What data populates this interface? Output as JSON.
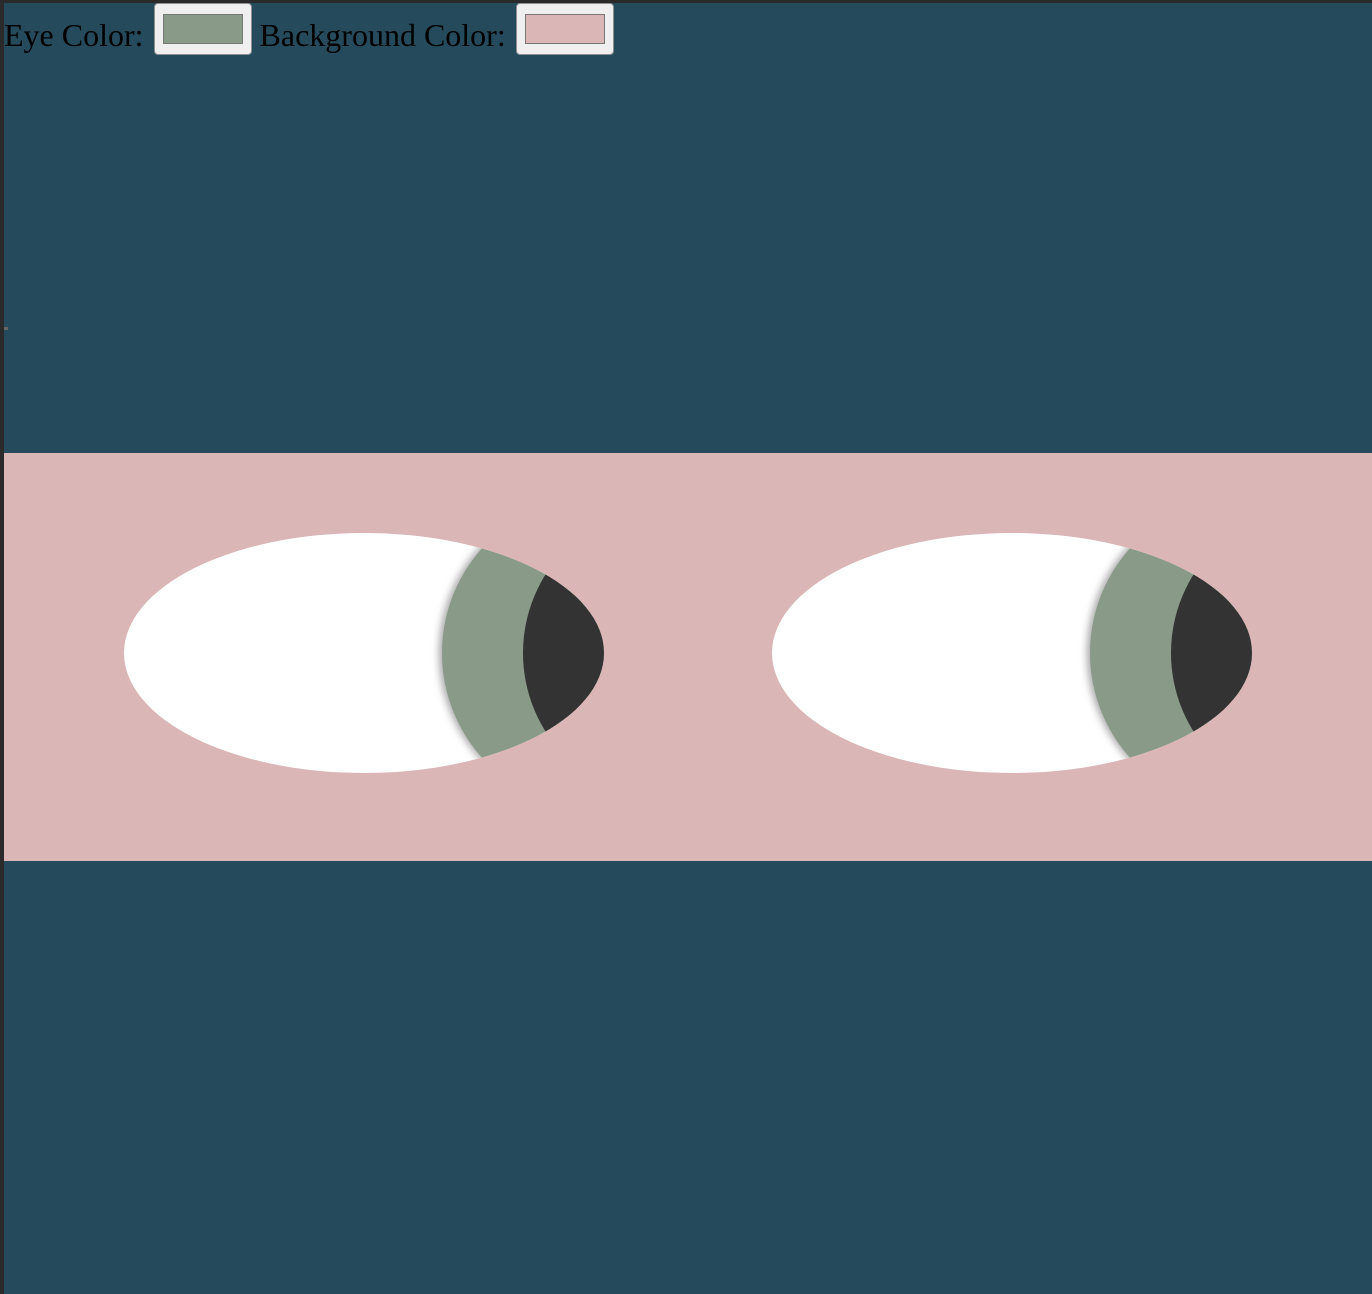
{
  "controls": {
    "eye_color_label": "Eye Color:",
    "background_color_label": "Background Color:",
    "eye_color_value": "#8a9a88",
    "background_color_value": "#dbb6b7"
  },
  "colors": {
    "page_background": "#244a5c",
    "band_background": "#dbb6b7",
    "sclera": "#ffffff",
    "iris": "#8a9a88",
    "pupil": "#333333"
  },
  "eyes": [
    {
      "name": "left-eye",
      "icon": "eye-icon"
    },
    {
      "name": "right-eye",
      "icon": "eye-icon"
    }
  ]
}
